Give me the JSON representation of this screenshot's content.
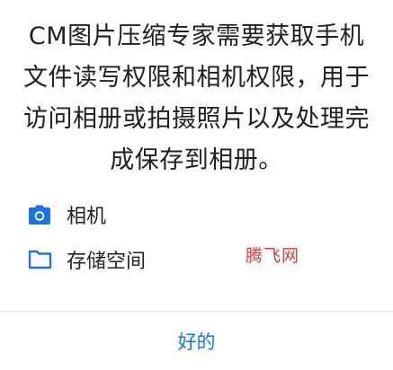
{
  "dialog": {
    "message": "CM图片压缩专家需要获取手机文件读写权限和相机权限，用于访问相册或拍摄照片以及处理完成保存到相册。",
    "permissions": [
      {
        "icon": "camera-icon",
        "label": "相机"
      },
      {
        "icon": "folder-icon",
        "label": "存储空间"
      }
    ],
    "watermark": "腾飞网",
    "ok_label": "好的"
  },
  "colors": {
    "accent": "#1a73e8",
    "watermark": "#e53935",
    "text": "#202124",
    "divider": "#e6e6e6"
  }
}
